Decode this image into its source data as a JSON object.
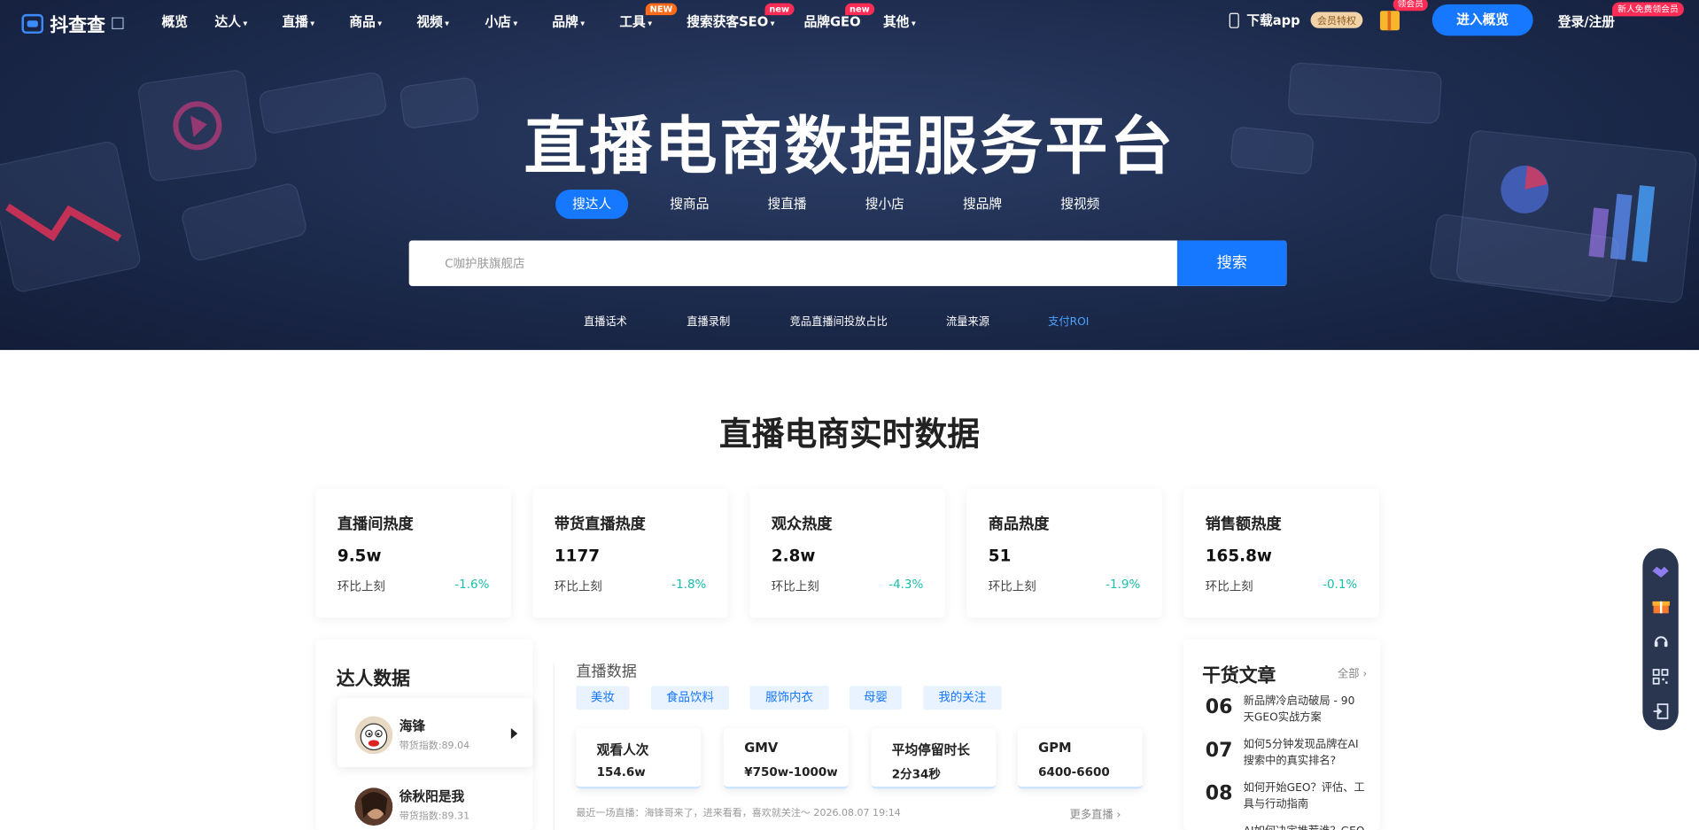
{
  "nav": {
    "logo": "抖查查",
    "items": [
      {
        "label": "概览",
        "chevron": false
      },
      {
        "label": "达人",
        "chevron": true
      },
      {
        "label": "直播",
        "chevron": true
      },
      {
        "label": "商品",
        "chevron": true
      },
      {
        "label": "视频",
        "chevron": true
      },
      {
        "label": "小店",
        "chevron": true
      },
      {
        "label": "品牌",
        "chevron": true
      },
      {
        "label": "工具",
        "chevron": true,
        "badge": "NEW"
      },
      {
        "label": "搜索获客SEO",
        "chevron": true,
        "badge": "new"
      },
      {
        "label": "品牌GEO",
        "chevron": false,
        "badge": "new"
      },
      {
        "label": "其他",
        "chevron": true
      }
    ],
    "download_app": "下载app",
    "vip_tag": "会员特权",
    "gift_badge": "领会员",
    "enter_button": "进入概览",
    "login": "登录/注册",
    "newuser_badge": "新人免费领会员"
  },
  "hero": {
    "title": "直播电商数据服务平台",
    "search_tabs": [
      "搜达人",
      "搜商品",
      "搜直播",
      "搜小店",
      "搜品牌",
      "搜视频"
    ],
    "active_tab": "搜达人",
    "search_placeholder": "C咖护肤旗舰店",
    "search_button": "搜索",
    "quick_links": [
      "直播话术",
      "直播录制",
      "竞品直播间投放占比",
      "流量来源",
      "支付ROI"
    ]
  },
  "realtime": {
    "title": "直播电商实时数据",
    "change_label": "环比上刻",
    "cards": [
      {
        "title": "直播间热度",
        "value": "9.5w",
        "change": "-1.6%"
      },
      {
        "title": "带货直播热度",
        "value": "1177",
        "change": "-1.8%"
      },
      {
        "title": "观众热度",
        "value": "2.8w",
        "change": "-4.3%"
      },
      {
        "title": "商品热度",
        "value": "51",
        "change": "-1.9%"
      },
      {
        "title": "销售额热度",
        "value": "165.8w",
        "change": "-0.1%"
      }
    ]
  },
  "kol_panel": {
    "title": "达人数据",
    "items": [
      {
        "name": "海锋",
        "index": "带货指数:89.04"
      },
      {
        "name": "徐秋阳是我",
        "index": "带货指数:89.31"
      }
    ]
  },
  "live_panel": {
    "title": "直播数据",
    "categories": [
      "美妆",
      "食品饮料",
      "服饰内衣",
      "母婴",
      "我的关注"
    ],
    "metrics": [
      {
        "title": "观看人次",
        "value": "154.6w"
      },
      {
        "title": "GMV",
        "value": "¥750w-1000w"
      },
      {
        "title": "平均停留时长",
        "value": "2分34秒"
      },
      {
        "title": "GPM",
        "value": "6400-6600"
      }
    ],
    "latest": "最近一场直播：海锋哥来了，进来看看，喜欢就关注～  2026.08.07 19:14",
    "more": "更多直播 ›"
  },
  "articles": {
    "title": "干货文章",
    "all": "全部 ›",
    "items": [
      {
        "num": "06",
        "text": "新品牌冷启动破局 - 90天GEO实战方案"
      },
      {
        "num": "07",
        "text": "如何5分钟发现品牌在AI搜索中的真实排名?"
      },
      {
        "num": "08",
        "text": "如何开始GEO？评估、工具与行动指南"
      },
      {
        "num": "",
        "text": "AI如何决定推荐谁？GEO"
      }
    ]
  },
  "colors": {
    "brand": "#1677ff",
    "hero_bg": "#1c2a4c",
    "positive_change": "#18c0a8"
  }
}
